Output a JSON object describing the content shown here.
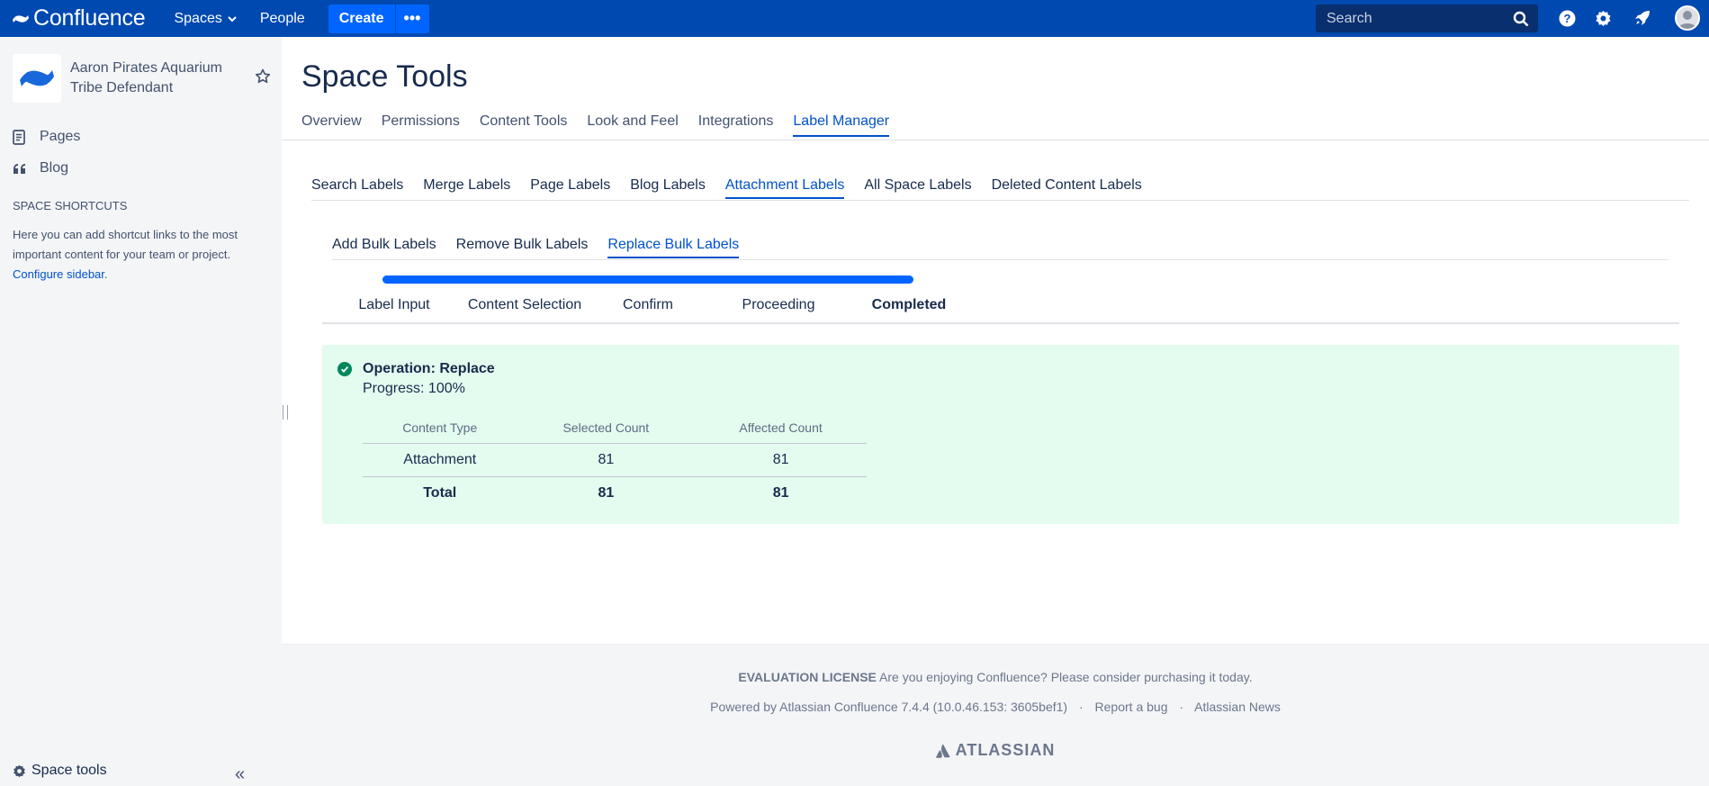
{
  "header": {
    "app_name": "Confluence",
    "spaces_label": "Spaces",
    "people_label": "People",
    "create_label": "Create",
    "more_label": "•••",
    "search_placeholder": "Search",
    "brand_color": "#0049b0"
  },
  "sidebar": {
    "space_name": "Aaron Pirates Aquarium Tribe Defendant",
    "items": [
      {
        "label": "Pages",
        "icon": "page-icon"
      },
      {
        "label": "Blog",
        "icon": "quote-icon"
      }
    ],
    "shortcuts_heading": "SPACE SHORTCUTS",
    "shortcuts_text": "Here you can add shortcut links to the most important content for your team or project.",
    "configure_link": "Configure sidebar",
    "shortcuts_tail": ".",
    "space_tools_label": "Space tools",
    "collapse_label": "«"
  },
  "main": {
    "title": "Space Tools",
    "tabs": [
      "Overview",
      "Permissions",
      "Content Tools",
      "Look and Feel",
      "Integrations",
      "Label Manager"
    ],
    "label_tabs": [
      "Search Labels",
      "Merge Labels",
      "Page Labels",
      "Blog Labels",
      "Attachment Labels",
      "All Space Labels",
      "Deleted Content Labels"
    ],
    "bulk_tabs": [
      "Add Bulk Labels",
      "Remove Bulk Labels",
      "Replace Bulk Labels"
    ],
    "progress_fraction": 1.0,
    "steps": [
      "Label Input",
      "Content Selection",
      "Confirm",
      "Proceeding",
      "Completed"
    ],
    "result": {
      "operation": "Operation: Replace",
      "progress": "Progress: 100%",
      "columns": [
        "Content Type",
        "Selected Count",
        "Affected Count"
      ],
      "rows": [
        {
          "type": "Attachment",
          "selected": "81",
          "affected": "81"
        }
      ],
      "total": {
        "type": "Total",
        "selected": "81",
        "affected": "81"
      }
    }
  },
  "footer": {
    "license_bold": "EVALUATION LICENSE",
    "license_text": "Are you enjoying Confluence? Please consider purchasing it today.",
    "powered": "Powered by Atlassian Confluence 7.4.4 (10.0.46.153: 3605bef1)",
    "report_bug": "Report a bug",
    "news": "Atlassian News",
    "separator": "·",
    "atlassian": "ATLASSIAN"
  }
}
